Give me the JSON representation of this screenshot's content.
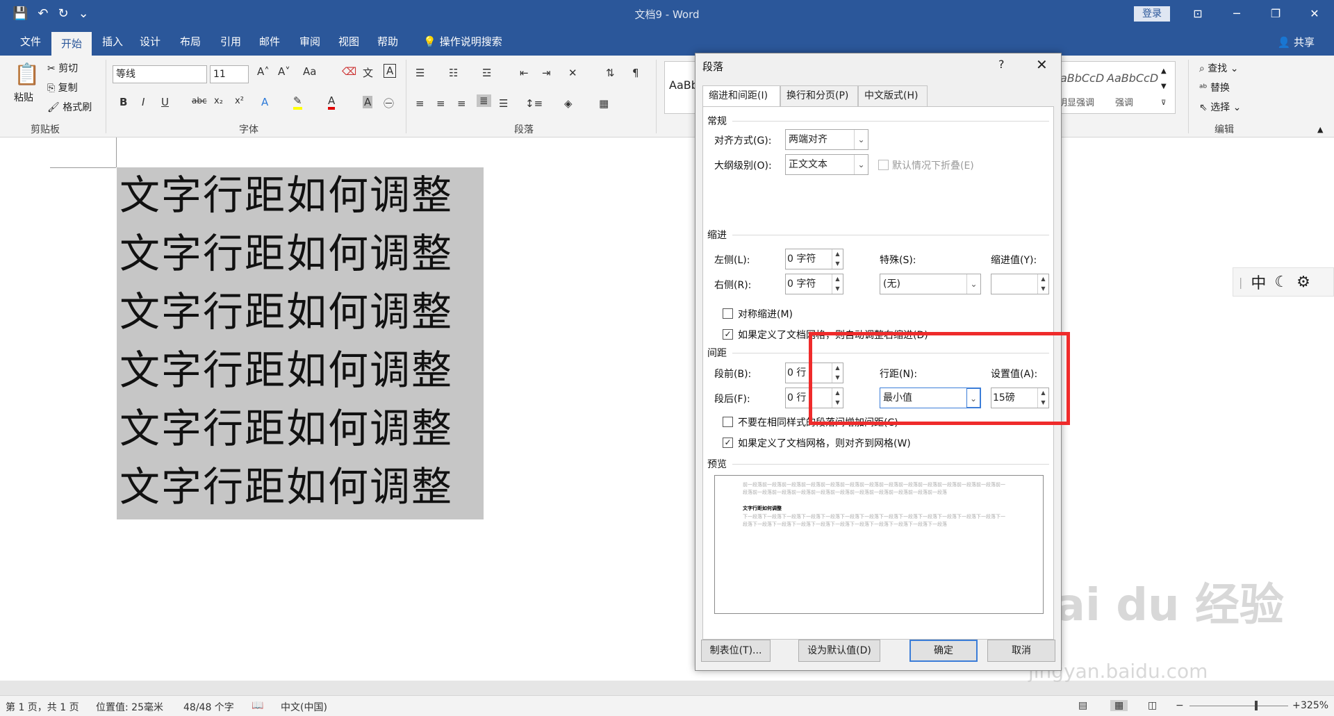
{
  "titlebar": {
    "doc_title": "文档9 - Word",
    "login": "登录",
    "qat": [
      "💾",
      "↶",
      "↻",
      "⌄"
    ],
    "win": [
      "⊡",
      "─",
      "❐",
      "✕"
    ]
  },
  "tabs": [
    "文件",
    "开始",
    "插入",
    "设计",
    "布局",
    "引用",
    "邮件",
    "审阅",
    "视图",
    "帮助",
    "操作说明搜索"
  ],
  "share": "共享",
  "ribbon": {
    "paste": "粘贴",
    "cut": "剪切",
    "copy": "复制",
    "format_painter": "格式刷",
    "clipboard_label": "剪贴板",
    "font_name": "等线",
    "font_size": "11",
    "font_label": "字体",
    "paragraph_label": "段落",
    "styles": [
      "AaBb",
      "AaBbCcD",
      "AaBbCcD"
    ],
    "style_names": [
      "明显强调",
      "强调"
    ],
    "find": "查找",
    "replace": "替换",
    "select": "选择",
    "editing_label": "编辑"
  },
  "document": {
    "lines": [
      "文字行距如何调整",
      "文字行距如何调整",
      "文字行距如何调整",
      "文字行距如何调整",
      "文字行距如何调整",
      "文字行距如何调整"
    ]
  },
  "ime": {
    "mode": "中"
  },
  "statusbar": {
    "page": "第 1 页，共 1 页",
    "position": "位置值: 25毫米",
    "words": "48/48 个字",
    "lang": "中文(中国)",
    "zoom": "325%"
  },
  "dialog": {
    "title": "段落",
    "help": "?",
    "close": "✕",
    "tabs": [
      "缩进和间距(I)",
      "换行和分页(P)",
      "中文版式(H)"
    ],
    "general": {
      "label": "常规",
      "align_label": "对齐方式(G):",
      "align_value": "两端对齐",
      "outline_label": "大纲级别(O):",
      "outline_value": "正文文本",
      "collapse_label": "默认情况下折叠(E)"
    },
    "indent": {
      "label": "缩进",
      "left_label": "左侧(L):",
      "left_value": "0 字符",
      "right_label": "右侧(R):",
      "right_value": "0 字符",
      "special_label": "特殊(S):",
      "special_value": "(无)",
      "by_label": "缩进值(Y):",
      "by_value": "",
      "mirror_label": "对称缩进(M)",
      "auto_adjust_label": "如果定义了文档网格，则自动调整右缩进(D)"
    },
    "spacing": {
      "label": "间距",
      "before_label": "段前(B):",
      "before_value": "0 行",
      "after_label": "段后(F):",
      "after_value": "0 行",
      "line_label": "行距(N):",
      "line_value": "最小值",
      "at_label": "设置值(A):",
      "at_value": "15磅",
      "no_space_label": "不要在相同样式的段落间增加间距(C)",
      "snap_label": "如果定义了文档网格，则对齐到网格(W)"
    },
    "preview": {
      "label": "预览",
      "prev_text": "前一段落前一段落前一段落前一段落前一段落前一段落前一段落前一段落前一段落前一段落前一段落前一段落前一段落前一段落前一段落前一段落前一段落前一段落前一段落前一段落前一段落前一段落前一段落前一段落",
      "sample": "文字行距如何调整",
      "next_text": "下一段落下一段落下一段落下一段落下一段落下一段落下一段落下一段落下一段落下一段落下一段落下一段落下一段落下一段落下一段落下一段落下一段落下一段落下一段落下一段落下一段落下一段落下一段落下一段落"
    },
    "buttons": {
      "tabs": "制表位(T)...",
      "default": "设为默认值(D)",
      "ok": "确定",
      "cancel": "取消"
    }
  },
  "watermark": {
    "main": "Bai du 经验",
    "sub": "jingyan.baidu.com"
  },
  "colors": {
    "brand": "#2b579a",
    "highlight": "#ef2b2b",
    "selection": "#c6c6c6"
  }
}
